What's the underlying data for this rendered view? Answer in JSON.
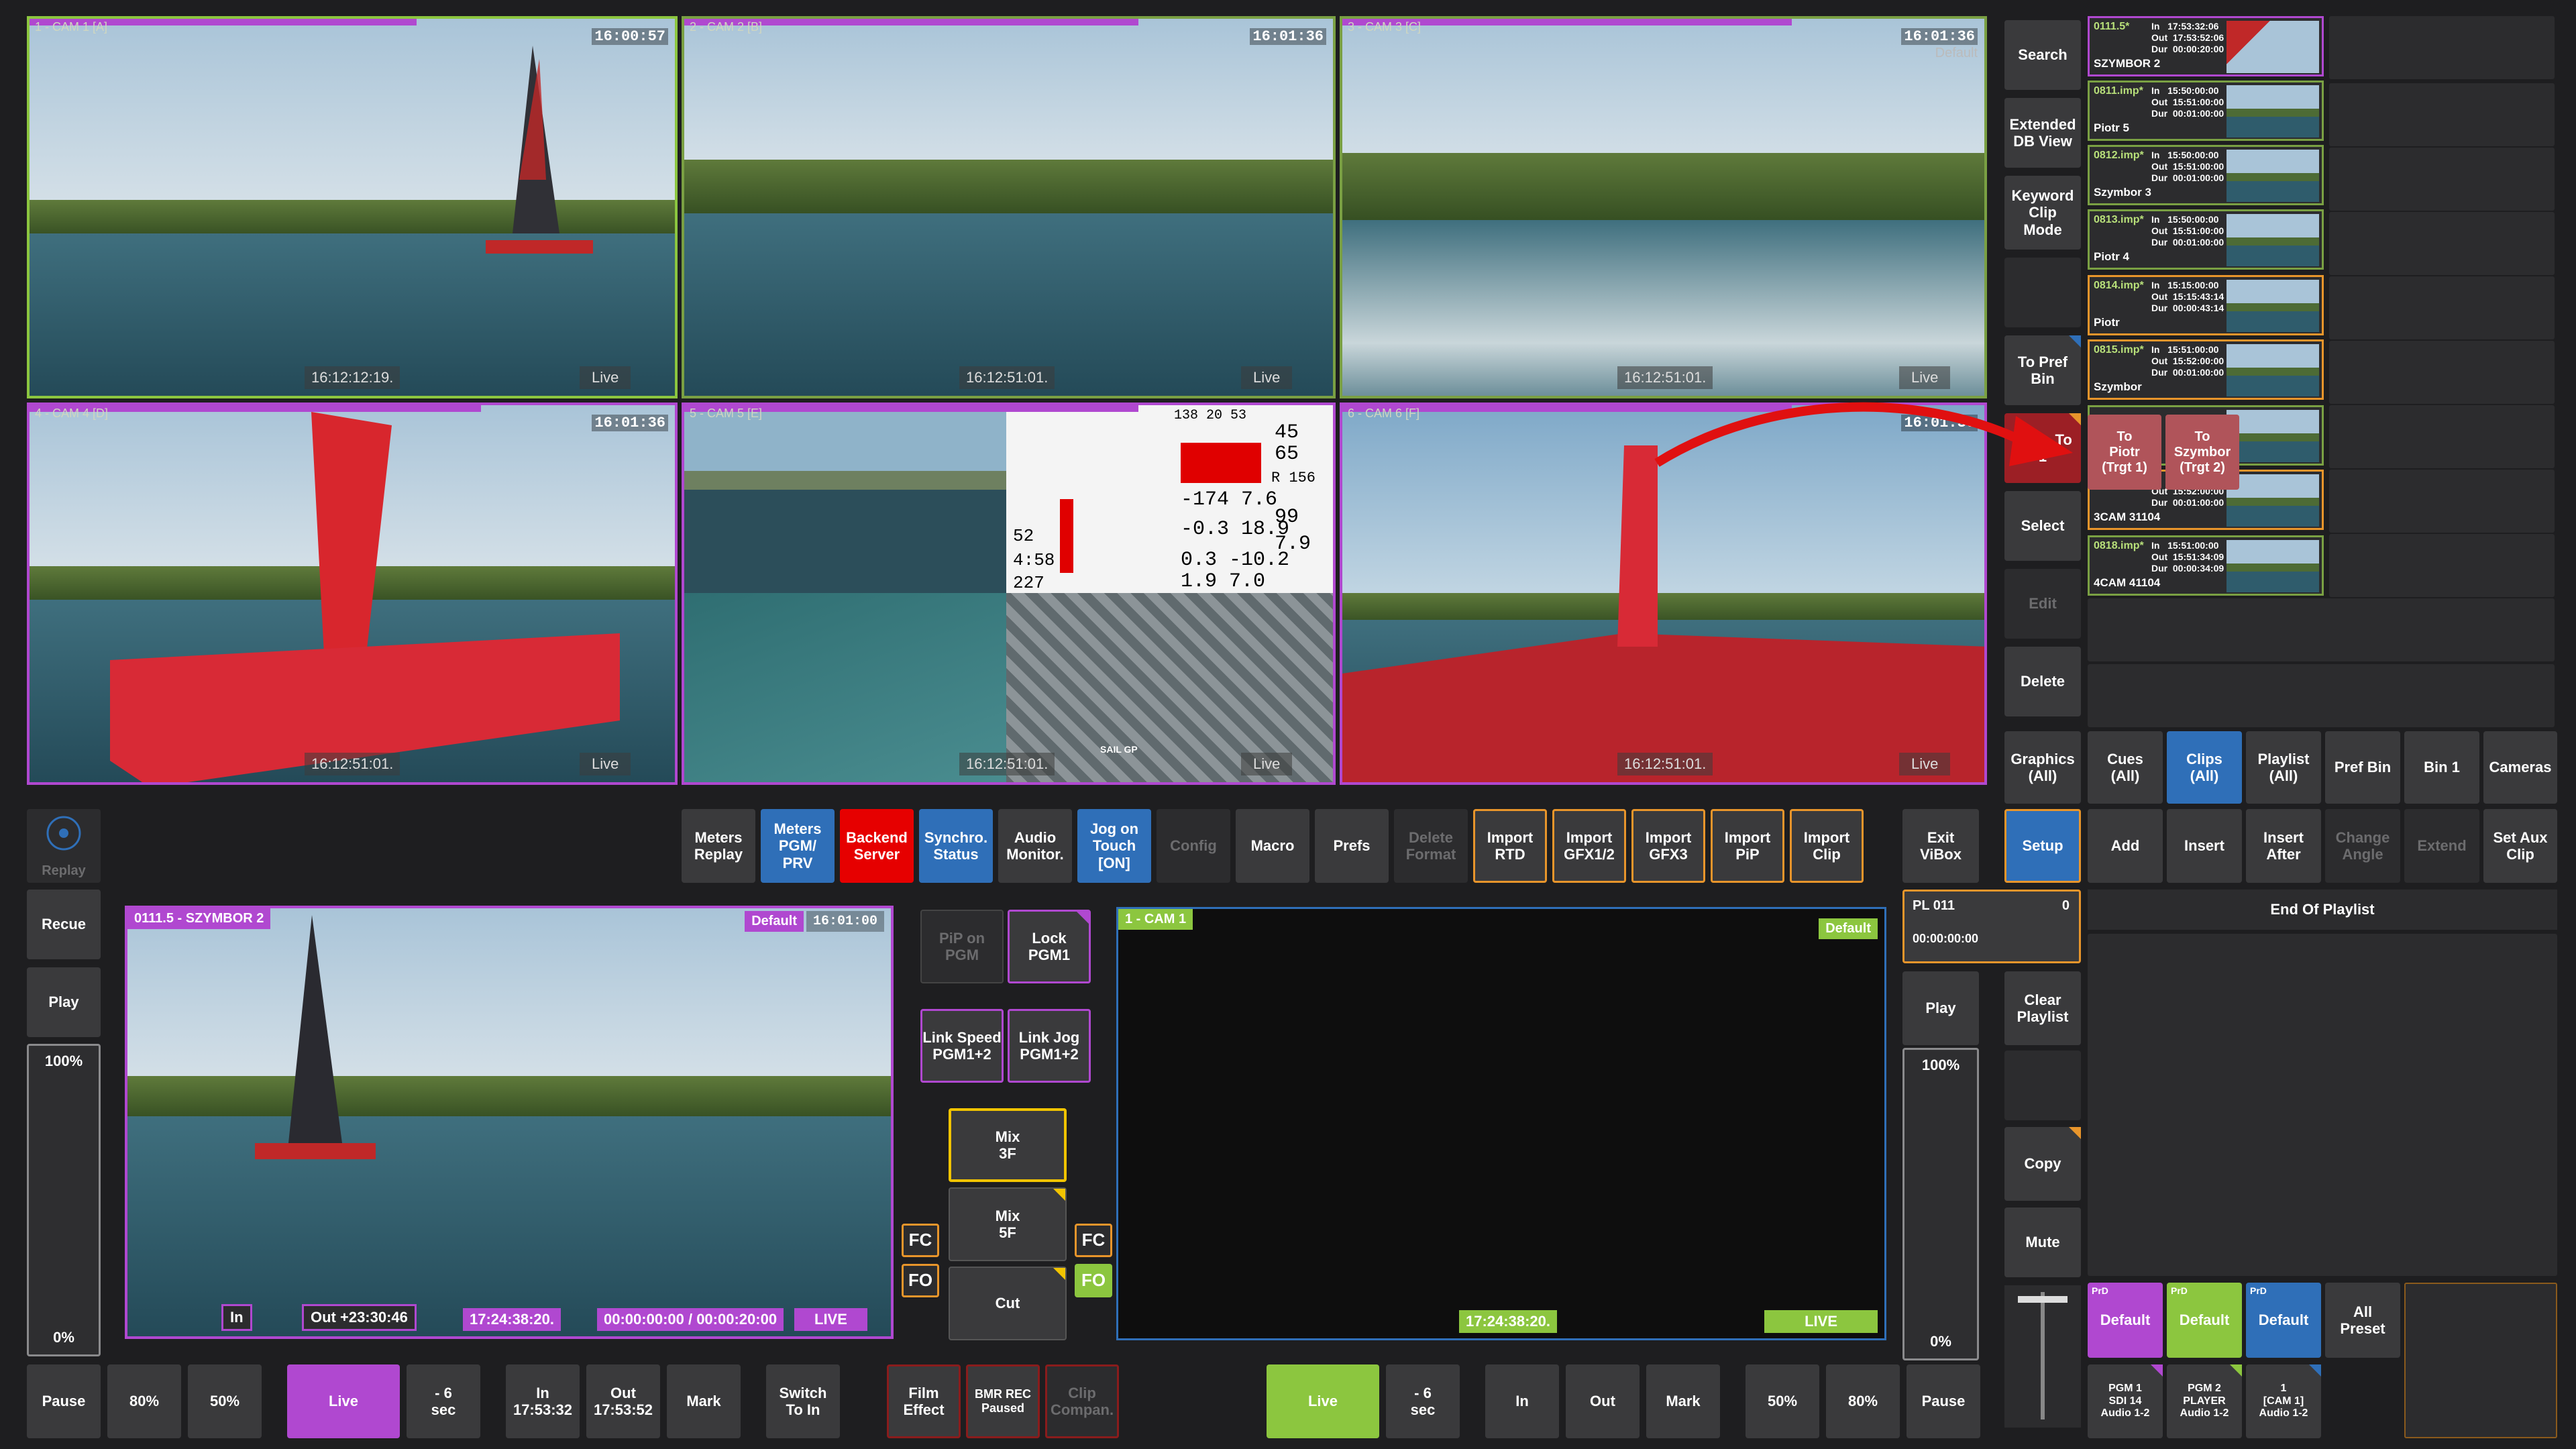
{
  "cams": [
    {
      "label": "1 - CAM 1 [A]",
      "tc": "16:00:57",
      "sub": "",
      "tcb": "16:12:12:19.",
      "live": "Live"
    },
    {
      "label": "2 - CAM 2 [B]",
      "tc": "16:01:36",
      "sub": "",
      "tcb": "16:12:51:01.",
      "live": "Live"
    },
    {
      "label": "3 - CAM 3 [C]",
      "tc": "16:01:36",
      "sub": "Default",
      "tcb": "16:12:51:01.",
      "live": "Live"
    },
    {
      "label": "4 - CAM 4 [D]",
      "tc": "16:01:36",
      "sub": "",
      "tcb": "16:12:51:01.",
      "live": "Live"
    },
    {
      "label": "5 - CAM 5 [E]",
      "tc": "",
      "sub": "",
      "tcb": "16:12:51:01.",
      "live": "Live"
    },
    {
      "label": "6 - CAM 6 [F]",
      "tc": "16:01:36",
      "sub": "",
      "tcb": "16:12:51:01.",
      "live": "Live"
    }
  ],
  "telemetry": {
    "top": "138  20  53",
    "v1": "45",
    "v2": "65",
    "r": "R 156",
    "v3": "-174  7.6",
    "v4": "99",
    "v5": "-0.3  18.9",
    "v6": "7.9",
    "v7": "0.3  -10.2",
    "v8": "1.9  7.0",
    "left1": "52",
    "left2": "4:58",
    "left3": "227",
    "map_label": "SAIL GP"
  },
  "right_tools": {
    "search": "Search",
    "extended": "Extended\nDB View",
    "keyword": "Keyword\nClip\nMode",
    "to_pref": "To Pref\nBin",
    "arch": "Arch. To\n1",
    "select": "Select",
    "edit": "Edit",
    "delete": "Delete"
  },
  "clips": [
    {
      "id": "0111.5*",
      "times": "In   17:53:32:06\nOut  17:53:52:06\nDur  00:00:20:00",
      "name": "SZYMBOR 2",
      "border": "#b048d0"
    },
    {
      "id": "0811.imp*",
      "times": "In   15:50:00:00\nOut  15:51:00:00\nDur  00:01:00:00",
      "name": "Piotr 5",
      "border": "#7aa043"
    },
    {
      "id": "0812.imp*",
      "times": "In   15:50:00:00\nOut  15:51:00:00\nDur  00:01:00:00",
      "name": "Szymbor 3",
      "border": "#7aa043"
    },
    {
      "id": "0813.imp*",
      "times": "In   15:50:00:00\nOut  15:51:00:00\nDur  00:01:00:00",
      "name": "Piotr 4",
      "border": "#7aa043"
    },
    {
      "id": "0814.imp*",
      "times": "In   15:15:00:00\nOut  15:15:43:14\nDur  00:00:43:14",
      "name": "Piotr",
      "border": "#e8952b"
    },
    {
      "id": "0815.imp*",
      "times": "In   15:51:00:00\nOut  15:52:00:00\nDur  00:01:00:00",
      "name": "Szymbor",
      "border": "#e8952b"
    },
    {
      "id": "",
      "times": "",
      "name": "",
      "border": "#7aa043"
    },
    {
      "id": "",
      "times": "In   15:51:00:00\nOut  15:52:00:00\nDur  00:01:00:00",
      "name": "3CAM 31104",
      "border": "#e8952b"
    },
    {
      "id": "0818.imp*",
      "times": "In   15:51:00:00\nOut  15:51:34:09\nDur  00:00:34:09",
      "name": "4CAM 41104",
      "border": "#7aa043"
    }
  ],
  "popup": {
    "t1": "To\nPiotr\n(Trgt 1)",
    "t2": "To\nSzymbor\n(Trgt 2)"
  },
  "bin_tabs": {
    "graphics": "Graphics\n(All)",
    "cues": "Cues\n(All)",
    "clips": "Clips\n(All)",
    "playlist": "Playlist\n(All)",
    "pref_bin": "Pref Bin",
    "bin1": "Bin 1",
    "cameras": "Cameras"
  },
  "toolbar": {
    "meters_replay": "Meters\nReplay",
    "meters_pgm": "Meters\nPGM/\nPRV",
    "backend": "Backend\nServer",
    "synchro": "Synchro.\nStatus",
    "audio": "Audio\nMonitor.",
    "jog": "Jog on\nTouch\n[ON]",
    "config": "Config",
    "macro": "Macro",
    "prefs": "Prefs",
    "delete_format": "Delete\nFormat",
    "import_rtd": "Import\nRTD",
    "import_gfx12": "Import\nGFX1/2",
    "import_gfx3": "Import\nGFX3",
    "import_pip": "Import\nPiP",
    "import_clip": "Import\nClip",
    "exit_vibox": "Exit\nViBox",
    "replay": "Replay"
  },
  "playlist_tools": {
    "setup": "Setup",
    "add": "Add",
    "insert": "Insert",
    "insert_after": "Insert\nAfter",
    "change_angle": "Change\nAngle",
    "extend": "Extend",
    "set_aux": "Set Aux\nClip",
    "end": "End Of Playlist"
  },
  "pl": {
    "name": "PL 011",
    "count": "0",
    "time": "00:00:00:00",
    "clear": "Clear\nPlaylist",
    "play": "Play",
    "copy": "Copy",
    "mute": "Mute",
    "speed_top": "100%",
    "speed_bot": "0%",
    "pause": "Pause"
  },
  "left_player": {
    "recue": "Recue",
    "play": "Play",
    "speed_top": "100%",
    "speed_bot": "0%",
    "title": "0111.5 - SZYMBOR 2",
    "default": "Default",
    "tc": "16:01:00",
    "in": "In",
    "out": "Out +23:30:46",
    "tc_pos": "17:24:38:20.",
    "duration": "00:00:00:00 / 00:00:20:00",
    "live": "LIVE"
  },
  "mix_panel": {
    "pip": "PiP on\nPGM",
    "lock": "Lock\nPGM1",
    "link_speed": "Link Speed\nPGM1+2",
    "link_jog": "Link Jog\nPGM1+2",
    "mix3": "Mix\n3F",
    "mix5": "Mix\n5F",
    "cut": "Cut",
    "fc": "FC",
    "fo": "FO"
  },
  "pgm_player": {
    "title": "1 - CAM 1",
    "default": "Default",
    "tc": "17:24:38:20.",
    "live": "LIVE"
  },
  "bottom_left": {
    "pause": "Pause",
    "p80": "80%",
    "p50": "50%",
    "live": "Live",
    "m6": "- 6\nsec",
    "in": "In\n17:53:32",
    "out": "Out\n17:53:52",
    "mark": "Mark",
    "switch": "Switch\nTo In",
    "film": "Film\nEffect",
    "bmr": "BMR REC\nPaused",
    "clip_comp": "Clip\nCompan."
  },
  "bottom_right": {
    "live": "Live",
    "m6": "- 6\nsec",
    "in": "In",
    "out": "Out",
    "mark": "Mark",
    "p50": "50%",
    "p80": "80%",
    "pause": "Pause"
  },
  "presets": [
    {
      "tag": "PrD",
      "label": "Default",
      "color": "#b048d0"
    },
    {
      "tag": "PrD",
      "label": "Default",
      "color": "#8cc63f"
    },
    {
      "tag": "PrD",
      "label": "Default",
      "color": "#2f6fb8"
    }
  ],
  "all_preset": "All\nPreset",
  "audio_out": [
    {
      "label": "PGM 1\nSDI 14\nAudio 1-2"
    },
    {
      "label": "PGM 2\nPLAYER\nAudio 1-2"
    },
    {
      "label": "1\n[CAM 1]\nAudio 1-2"
    }
  ],
  "colors": {
    "accent_green": "#8cc63f",
    "accent_purple": "#b048d0",
    "accent_blue": "#2f6fb8",
    "accent_orange": "#e8952b",
    "alert_red": "#e60000"
  }
}
